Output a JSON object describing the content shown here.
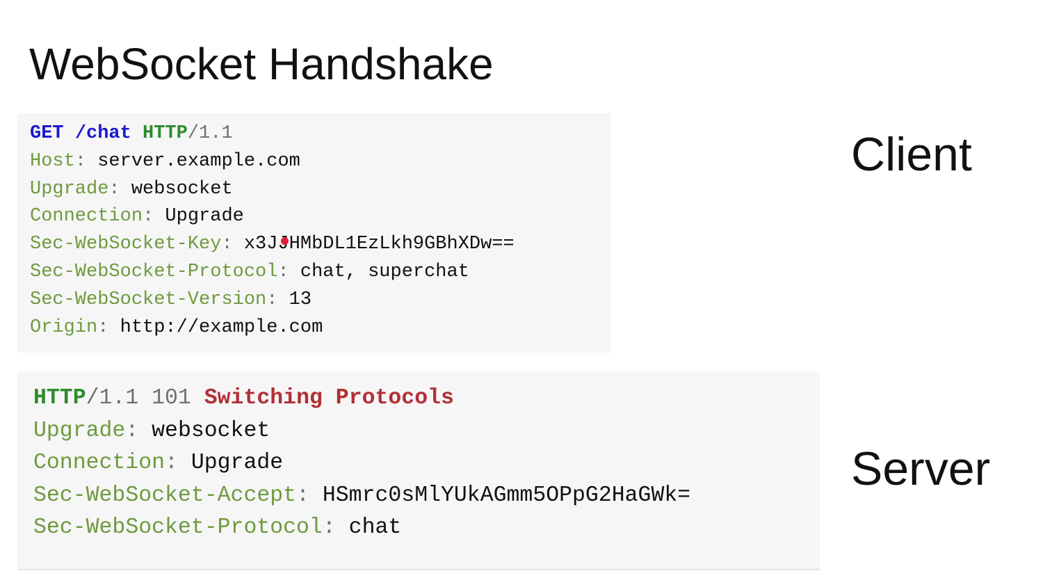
{
  "slide": {
    "title": "WebSocket Handshake",
    "client_label": "Client",
    "server_label": "Server"
  },
  "request": {
    "method": "GET",
    "path": "/chat",
    "protocol": "HTTP",
    "version": "/1.1",
    "headers": [
      {
        "name": "Host",
        "sep": ":",
        "value": " server.example.com"
      },
      {
        "name": "Upgrade",
        "sep": ":",
        "value": " websocket"
      },
      {
        "name": "Connection",
        "sep": ":",
        "value": " Upgrade"
      },
      {
        "name": "Sec-WebSocket-Key",
        "sep": ":",
        "value": " x3JJHMbDL1EzLkh9GBhXDw=="
      },
      {
        "name": "Sec-WebSocket-Protocol",
        "sep": ":",
        "value": " chat, superchat"
      },
      {
        "name": "Sec-WebSocket-Version",
        "sep": ":",
        "value": " 13"
      },
      {
        "name": "Origin",
        "sep": ":",
        "value": " http://example.com"
      }
    ]
  },
  "response": {
    "protocol": "HTTP",
    "version": "/1.1 101 ",
    "status_text": "Switching Protocols",
    "headers": [
      {
        "name": "Upgrade",
        "sep": ":",
        "value": " websocket"
      },
      {
        "name": "Connection",
        "sep": ":",
        "value": " Upgrade"
      },
      {
        "name": "Sec-WebSocket-Accept",
        "sep": ":",
        "value": " HSmrc0sMlYUkAGmm5OPpG2HaGWk="
      },
      {
        "name": "Sec-WebSocket-Protocol",
        "sep": ":",
        "value": " chat"
      }
    ]
  },
  "colors": {
    "method": "#1a1acc",
    "protocol": "#2e8b2e",
    "header_name": "#6e9a3e",
    "status_text": "#b22f35",
    "pointer": "#e0203a",
    "code_background": "#f6f6f6"
  }
}
